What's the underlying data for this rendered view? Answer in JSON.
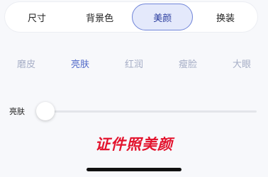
{
  "tabs": [
    {
      "label": "尺寸"
    },
    {
      "label": "背景色"
    },
    {
      "label": "美颜"
    },
    {
      "label": "换装"
    }
  ],
  "active_tab": "美颜",
  "effects": [
    {
      "label": "磨皮"
    },
    {
      "label": "亮肤"
    },
    {
      "label": "红润"
    },
    {
      "label": "瘦脸"
    },
    {
      "label": "大眼"
    }
  ],
  "active_effect": "亮肤",
  "slider": {
    "label": "亮肤",
    "value": 0
  },
  "watermark": "证件照美颜",
  "colors": {
    "accent": "#6f84d8",
    "active_tab_bg": "#e4e9fb",
    "effect_active": "#4f68c8",
    "effect_inactive": "#a6aec6",
    "watermark": "#e3142e"
  }
}
